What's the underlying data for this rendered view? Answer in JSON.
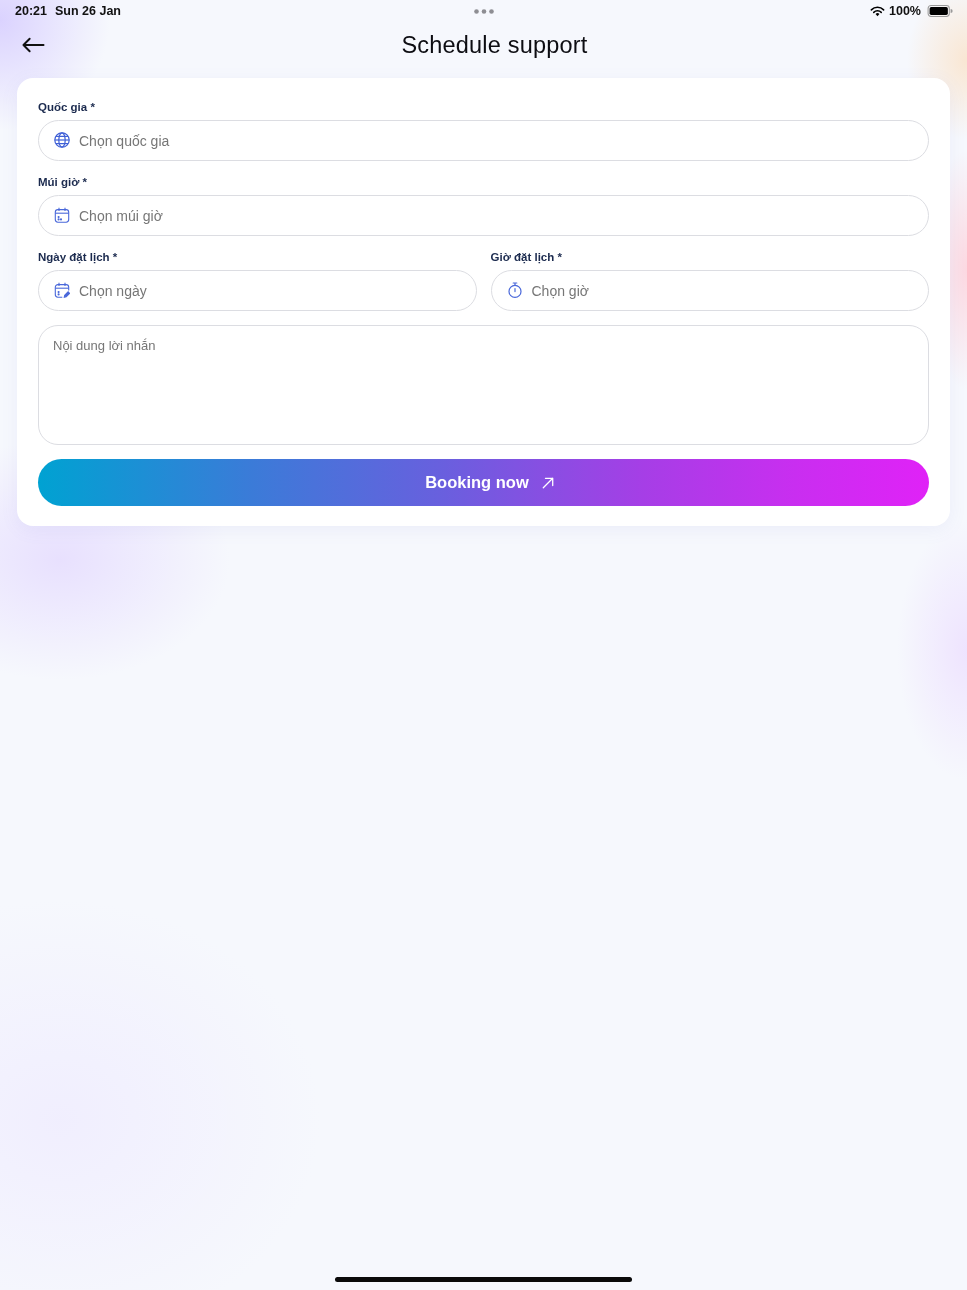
{
  "status_bar": {
    "time": "20:21",
    "date": "Sun 26 Jan",
    "battery": "100%"
  },
  "header": {
    "title": "Schedule support"
  },
  "form": {
    "rows": [
      [
        {
          "label": "Quốc gia *",
          "placeholder": "Chọn quốc gia"
        }
      ],
      [
        {
          "label": "Múi giờ *",
          "placeholder": "Chọn múi giờ"
        }
      ],
      [
        {
          "label": "Ngày đặt lịch *",
          "placeholder": "Chọn ngày"
        },
        {
          "label": "Giờ đặt lịch *",
          "placeholder": "Chọn giờ"
        }
      ]
    ],
    "message": {
      "placeholder": "Nội dung lời nhắn"
    },
    "submit_button": {
      "label": "Booking now"
    }
  }
}
